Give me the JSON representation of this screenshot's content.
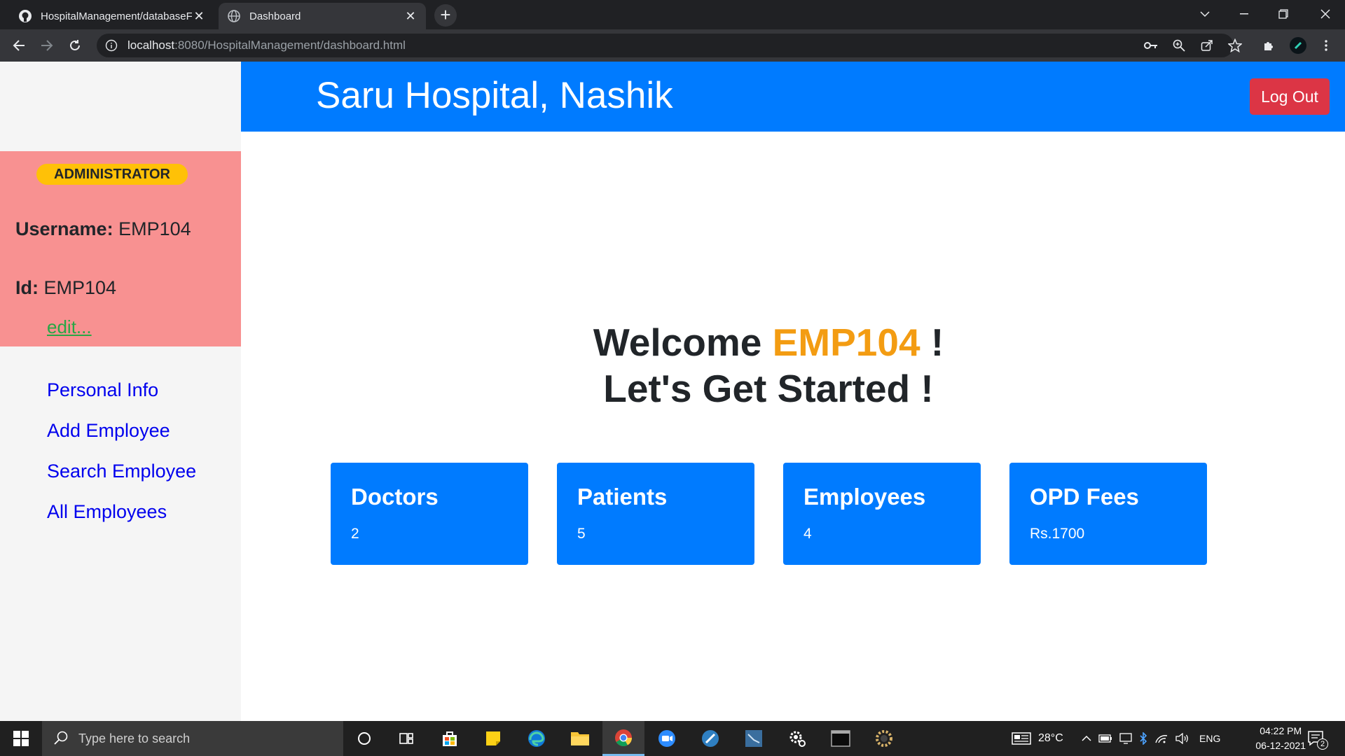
{
  "browser": {
    "tabs": [
      {
        "title": "HospitalManagement/databaseF",
        "active": false,
        "icon": "github-icon"
      },
      {
        "title": "Dashboard",
        "active": true,
        "icon": "globe-icon"
      }
    ],
    "url_host": "localhost",
    "url_path": ":8080/HospitalManagement/dashboard.html"
  },
  "header": {
    "title": "Saru Hospital, Nashik",
    "logout_label": "Log Out"
  },
  "profile": {
    "role": "ADMINISTRATOR",
    "username_label": "Username:",
    "username": "EMP104",
    "id_label": "Id:",
    "id": "EMP104",
    "edit_label": "edit..."
  },
  "nav": {
    "items": [
      {
        "label": "Personal Info"
      },
      {
        "label": "Add Employee"
      },
      {
        "label": "Search Employee"
      },
      {
        "label": "All Employees"
      }
    ]
  },
  "welcome": {
    "prefix": "Welcome",
    "user": "EMP104",
    "suffix": "!",
    "line2": "Let's Get Started !"
  },
  "stats": [
    {
      "title": "Doctors",
      "value": "2"
    },
    {
      "title": "Patients",
      "value": "5"
    },
    {
      "title": "Employees",
      "value": "4"
    },
    {
      "title": "OPD Fees",
      "value": "Rs.1700"
    }
  ],
  "taskbar": {
    "search_placeholder": "Type here to search",
    "weather": "28°C",
    "language": "ENG",
    "time": "04:22 PM",
    "date": "06-12-2021",
    "notification_count": "2"
  },
  "colors": {
    "primary": "#007bff",
    "danger": "#dc3545",
    "warning": "#ffc107",
    "profile_bg": "#f89191",
    "welcome_user": "#f39c12"
  }
}
